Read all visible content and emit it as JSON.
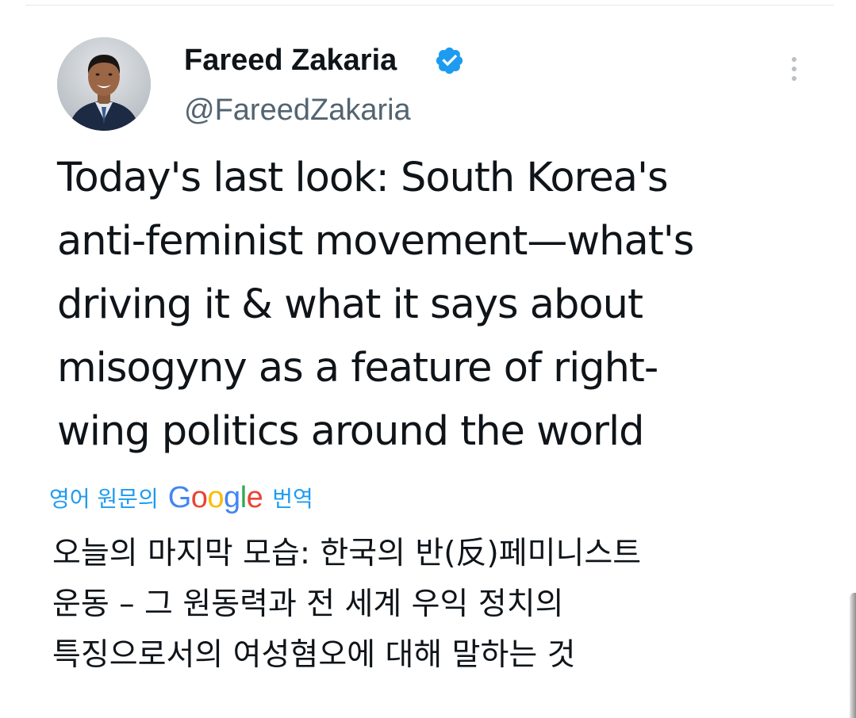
{
  "author": {
    "name": "Fareed Zakaria",
    "handle": "@FareedZakaria",
    "verified": true,
    "verified_color": "#1d9bf0"
  },
  "tweet": {
    "lines": [
      "Today's last look: South Korea's",
      "anti-feminist movement—what's",
      "driving it & what it says about",
      "misogyny as a feature of right-",
      "wing politics around the world"
    ]
  },
  "translation": {
    "prefix": "영어 원문의",
    "logo_letters": [
      "G",
      "o",
      "o",
      "g",
      "l",
      "e"
    ],
    "suffix": "번역",
    "lines": [
      "오늘의 마지막 모습: 한국의 반(反)페미니스트",
      "운동 – 그 원동력과 전 세계 우익 정치의",
      "특징으로서의 여성혐오에 대해 말하는 것"
    ]
  },
  "icons": {
    "more": "more-vertical-icon",
    "verified": "verified-badge-icon"
  },
  "colors": {
    "text_primary": "#0f1419",
    "text_secondary": "#536471",
    "link": "#1d9bf0",
    "google_blue": "#4285f4",
    "google_red": "#ea4335",
    "google_yellow": "#fbbc05",
    "google_green": "#34a853"
  }
}
